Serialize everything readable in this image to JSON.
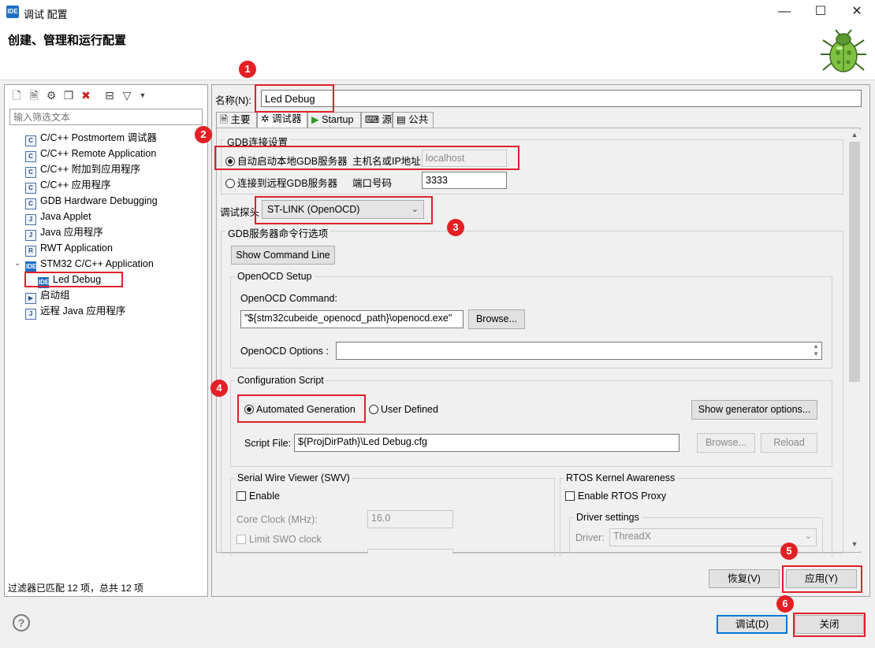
{
  "window": {
    "title": "调试 配置",
    "header_title": "创建、管理和运行配置",
    "badge": "IDE",
    "minimize": "—",
    "maximize": "☐",
    "close": "✕"
  },
  "left": {
    "filter_placeholder": "输入筛选文本",
    "tree": [
      {
        "label": "C/C++ Postmortem 调试器",
        "icon": "C"
      },
      {
        "label": "C/C++ Remote Application",
        "icon": "C"
      },
      {
        "label": "C/C++ 附加到应用程序",
        "icon": "C"
      },
      {
        "label": "C/C++ 应用程序",
        "icon": "C"
      },
      {
        "label": "GDB Hardware Debugging",
        "icon": "C"
      },
      {
        "label": "Java Applet",
        "icon": "J"
      },
      {
        "label": "Java 应用程序",
        "icon": "J"
      },
      {
        "label": "RWT Application",
        "icon": "R"
      },
      {
        "label": "STM32 C/C++ Application",
        "icon": "IDE"
      },
      {
        "label": "Led Debug",
        "icon": "IDE"
      },
      {
        "label": "启动组",
        "icon": "▶"
      },
      {
        "label": "远程 Java 应用程序",
        "icon": "J"
      }
    ],
    "status": "过滤器已匹配 12 项，总共 12 项"
  },
  "config": {
    "name_label": "名称(N):",
    "name_value": "Led Debug",
    "tabs": [
      "主要",
      "调试器",
      "Startup",
      "源",
      "公共"
    ],
    "gdb_group": "GDB连接设置",
    "auto_local": "自动启动本地GDB服务器",
    "host_label": "主机名或IP地址",
    "host_value": "localhost",
    "connect_remote": "连接到远程GDB服务器",
    "port_label": "端口号码",
    "port_value": "3333",
    "probe_label": "调试探头",
    "probe_value": "ST-LINK (OpenOCD)",
    "server_group": "GDB服务器命令行选项",
    "show_cmd": "Show Command Line",
    "openocd_group": "OpenOCD Setup",
    "openocd_cmd_label": "OpenOCD Command:",
    "openocd_cmd_value": "\"${stm32cubeide_openocd_path}\\openocd.exe\"",
    "browse": "Browse...",
    "openocd_opts_label": "OpenOCD Options :",
    "script_group": "Configuration Script",
    "auto_gen": "Automated Generation",
    "user_defined": "User Defined",
    "show_gen": "Show generator options...",
    "script_file_label": "Script File:",
    "script_file_value": "${ProjDirPath}\\Led Debug.cfg",
    "browse2": "Browse...",
    "reload": "Reload",
    "swv_group": "Serial Wire Viewer (SWV)",
    "swv_enable": "Enable",
    "core_clock_label": "Core Clock (MHz):",
    "core_clock_value": "16.0",
    "limit_swo": "Limit SWO clock",
    "rtos_group": "RTOS Kernel Awareness",
    "rtos_enable": "Enable RTOS Proxy",
    "driver_group": "Driver settings",
    "driver_label": "Driver:",
    "driver_value": "ThreadX"
  },
  "buttons": {
    "revert": "恢复(V)",
    "apply": "应用(Y)",
    "debug": "调试(D)",
    "close": "关闭"
  },
  "markers": [
    "1",
    "2",
    "3",
    "4",
    "5",
    "6"
  ],
  "colors": {
    "annotation_red": "#e32025",
    "accent_blue": "#0078d7"
  }
}
